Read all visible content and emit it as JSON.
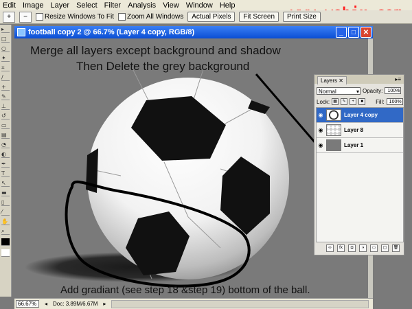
{
  "menu": [
    "Edit",
    "Image",
    "Layer",
    "Select",
    "Filter",
    "Analysis",
    "View",
    "Window",
    "Help"
  ],
  "watermark": "www.webjx.com",
  "options": {
    "resize_windows_to_fit": "Resize Windows To Fit",
    "zoom_all_windows": "Zoom All Windows",
    "actual_pixels": "Actual Pixels",
    "fit_screen": "Fit Screen",
    "print_size": "Print Size"
  },
  "document": {
    "title": "football copy 2 @ 66.7% (Layer 4 copy, RGB/8)"
  },
  "annotations": {
    "line1": "Merge all layers except background and shadow",
    "line2": "Then Delete the grey background",
    "bottom": "Add gradiant (see step 18 &step 19) bottom of the ball."
  },
  "layers_panel": {
    "tab": "Layers",
    "blend_mode": "Normal",
    "opacity_label": "Opacity:",
    "opacity_value": "100%",
    "lock_label": "Lock:",
    "fill_label": "Fill:",
    "fill_value": "100%",
    "layers": [
      {
        "name": "Layer 4 copy",
        "selected": true
      },
      {
        "name": "Layer 8",
        "selected": false
      },
      {
        "name": "Layer 1",
        "selected": false
      }
    ]
  },
  "status": {
    "zoom": "66.67%",
    "doc": "Doc: 3.89M/6.67M"
  },
  "colors": {
    "canvas_grey": "#7a7a7a",
    "selection_blue": "#3169c6",
    "watermark_red": "#ff2020"
  }
}
